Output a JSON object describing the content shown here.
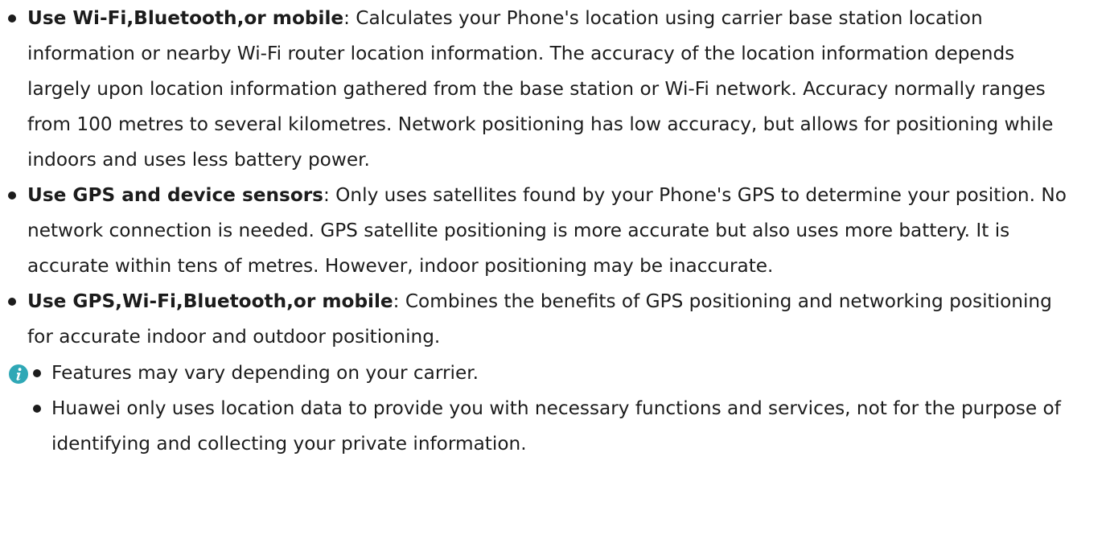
{
  "items": [
    {
      "term": "Use Wi-Fi,Bluetooth,or mobile",
      "description": ": Calculates your Phone's location using carrier base station location information or nearby Wi-Fi router location information. The accuracy of the location information depends largely upon location information gathered from the base station or Wi-Fi network. Accuracy normally ranges from 100 metres to several kilometres. Network positioning has low accuracy, but allows for positioning while indoors and uses less battery power."
    },
    {
      "term": "Use GPS and device sensors",
      "description": ": Only uses satellites found by your Phone's GPS to determine your position. No network connection is needed. GPS satellite positioning is more accurate but also uses more battery. It is accurate within tens of metres. However, indoor positioning may be inaccurate."
    },
    {
      "term": "Use GPS,Wi-Fi,Bluetooth,or mobile",
      "description": ": Combines the benefits of GPS positioning and networking positioning for accurate indoor and outdoor positioning."
    }
  ],
  "note": {
    "icon": "info-icon",
    "icon_color": "#2fa8b6",
    "items": [
      "Features may vary depending on your carrier.",
      "Huawei only uses location data to provide you with necessary functions and services, not for the purpose of identifying and collecting your private information."
    ]
  }
}
